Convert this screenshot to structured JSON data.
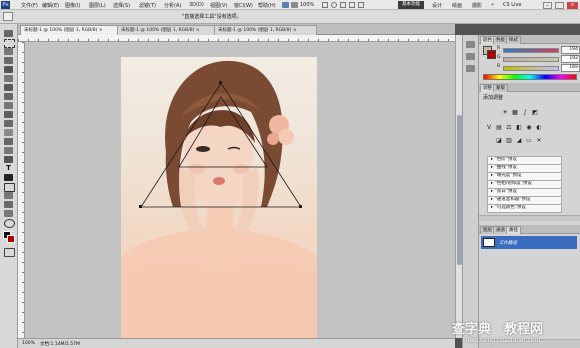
{
  "menu": {
    "items": [
      "文件(F)",
      "编辑(E)",
      "图像(I)",
      "图层(L)",
      "选择(S)",
      "滤镜(T)",
      "分析(A)",
      "3D(D)",
      "视图(V)",
      "窗口(W)",
      "帮助(H)"
    ],
    "zoom": "100%",
    "workspaces": [
      "基本功能",
      "设计",
      "绘画",
      "摄影"
    ],
    "cs_live": "CS Live"
  },
  "options_bar": {
    "message": "\"直接选择工具\"没有选项。"
  },
  "tabs": [
    {
      "label": "未标题-1 @ 100% (图层 1, RGB/8)",
      "active": true
    },
    {
      "label": "未标题-1 @ 100% (图层 1, RGB/8)",
      "active": false
    },
    {
      "label": "未标题-1 @ 100% (图层 1, RGB/8)",
      "active": false
    }
  ],
  "status": {
    "zoom": "100%",
    "doc": "文档:1.14M/2.57M"
  },
  "color_panel": {
    "tabs": [
      "颜色",
      "色板",
      "样式"
    ],
    "r": {
      "label": "R",
      "value": "194"
    },
    "g": {
      "label": "G",
      "value": "192"
    },
    "b": {
      "label": "B",
      "value": "169"
    },
    "accent": "#3a6dc0"
  },
  "adjust_panel": {
    "tabs": [
      "调整",
      "蒙版"
    ],
    "title": "添加调整",
    "presets": [
      "\"色阶\"预设",
      "\"曲线\"预设",
      "\"曝光度\"预设",
      "\"色相/饱和度\"预设",
      "\"黑白\"预设",
      "\"通道混和器\"预设",
      "\"可选颜色\"预设"
    ]
  },
  "layers_panel": {
    "tabs": [
      "图层",
      "通道",
      "路径"
    ],
    "path_name": "工作路径"
  },
  "watermark": {
    "main": "查字典",
    "sub": "教程网",
    "url": "jiaocheng.chazidian.com"
  }
}
